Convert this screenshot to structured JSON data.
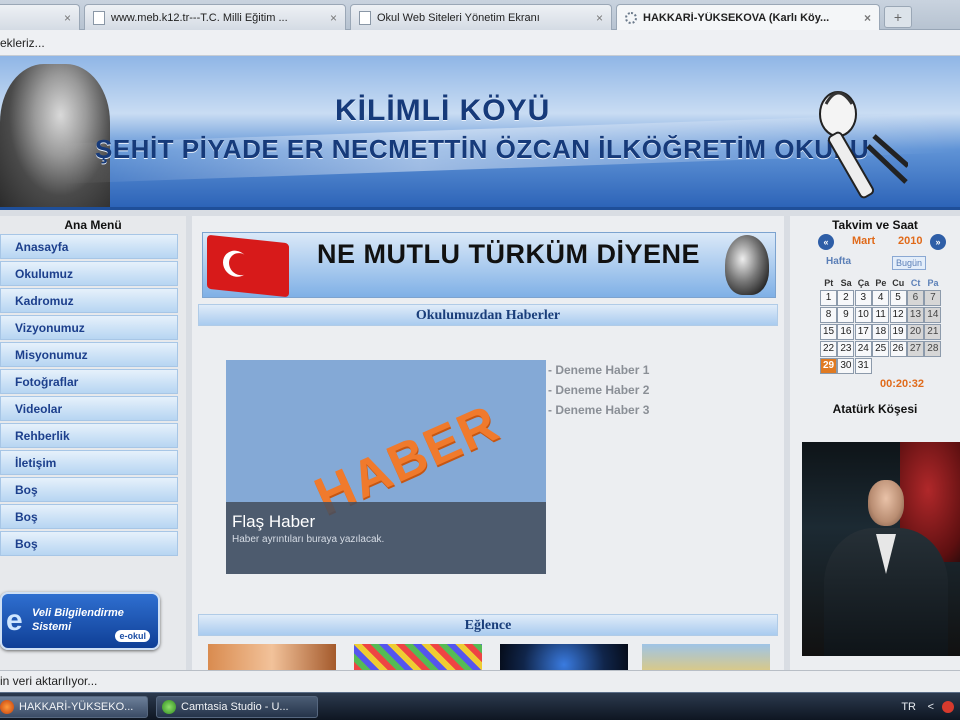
{
  "browser": {
    "tabs": [
      {
        "label": "",
        "active": false
      },
      {
        "label": "www.meb.k12.tr---T.C. Milli Eğitim ...",
        "active": false
      },
      {
        "label": "Okul Web Siteleri Yönetim Ekranı",
        "active": false
      },
      {
        "label": "HAKKARİ-YÜKSEKOVA (Karlı Köy...",
        "active": true
      }
    ],
    "close_glyph": "×",
    "newtab_glyph": "+",
    "bookmarks_text": "ekleriz..."
  },
  "banner": {
    "line1": "KİLİMLİ KÖYÜ",
    "line2": "ŞEHİT PİYADE ER NECMETTİN ÖZCAN İLKÖĞRETİM OKULU"
  },
  "left_menu": {
    "title": "Ana Menü",
    "items": [
      "Anasayfa",
      "Okulumuz",
      "Kadromuz",
      "Vizyonumuz",
      "Misyonumuz",
      "Fotoğraflar",
      "Videolar",
      "Rehberlik",
      "İletişim",
      "Boş",
      "Boş",
      "Boş"
    ],
    "veli": {
      "line1": "Veli Bilgilendirme",
      "line2": "Sistemi",
      "logo": "e-okul"
    }
  },
  "main": {
    "slogan": "NE MUTLU TÜRKÜM DİYENE",
    "news_section_title": "Okulumuzdan Haberler",
    "news_image_text": "HABER",
    "news_caption_title": "Flaş Haber",
    "news_caption_sub": "Haber ayrıntıları buraya yazılacak.",
    "news_items": [
      "- Deneme Haber 1",
      "- Deneme Haber 2",
      "- Deneme Haber 3"
    ],
    "fun_section_title": "Eğlence"
  },
  "right": {
    "calendar_title": "Takvim ve Saat",
    "prev_glyph": "«",
    "next_glyph": "»",
    "month": "Mart",
    "year": "2010",
    "week_tab": "Hafta",
    "today_tab": "Bugün",
    "weekdays": [
      "Pt",
      "Sa",
      "Ça",
      "Pe",
      "Cu",
      "Ct",
      "Pa"
    ],
    "weeks": [
      [
        "1",
        "2",
        "3",
        "4",
        "5",
        "6",
        "7"
      ],
      [
        "8",
        "9",
        "10",
        "11",
        "12",
        "13",
        "14"
      ],
      [
        "15",
        "16",
        "17",
        "18",
        "19",
        "20",
        "21"
      ],
      [
        "22",
        "23",
        "24",
        "25",
        "26",
        "27",
        "28"
      ],
      [
        "29",
        "30",
        "31",
        "",
        "",
        "",
        ""
      ]
    ],
    "today": "29",
    "clock": "00:20:32",
    "ataturk_title": "Atatürk Köşesi"
  },
  "status_text": "in veri aktarılıyor...",
  "taskbar": {
    "tasks": [
      "HAKKARİ-YÜKSEKO...",
      "Camtasia Studio - U..."
    ],
    "lang": "TR",
    "tray_arrow": "<"
  }
}
